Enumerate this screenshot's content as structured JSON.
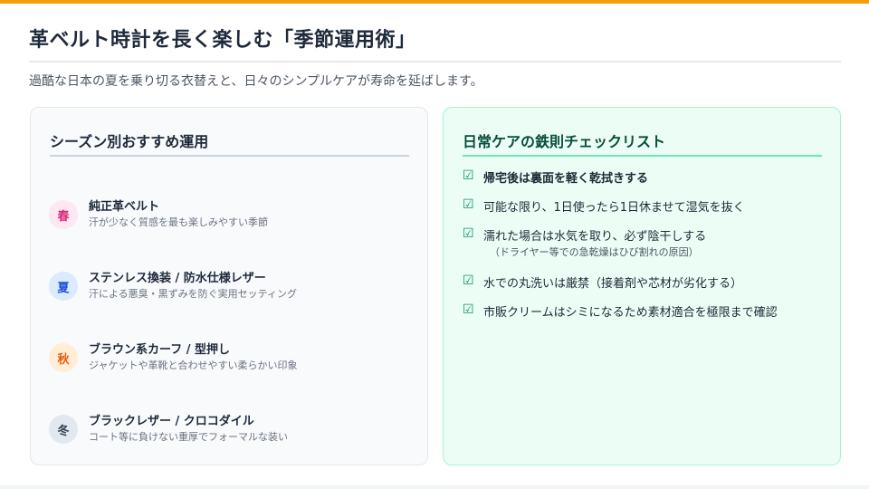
{
  "colors": {
    "accent_bar": "#f59e0b",
    "left_card_bg": "#f8fafc",
    "right_card_bg": "#ecfdf5",
    "check_mark": "#059669"
  },
  "header": {
    "title": "革ベルト時計を長く楽しむ「季節運用術」",
    "subtitle": "過酷な日本の夏を乗り切る衣替えと、日々のシンプルケアが寿命を延ばします。"
  },
  "seasons": {
    "title": "シーズン別おすすめ運用",
    "items": [
      {
        "badge": "春",
        "title": "純正革ベルト",
        "desc": "汗が少なく質感を最も楽しみやすい季節"
      },
      {
        "badge": "夏",
        "title": "ステンレス換装 / 防水仕様レザー",
        "desc": "汗による悪臭・黒ずみを防ぐ実用セッティング"
      },
      {
        "badge": "秋",
        "title": "ブラウン系カーフ / 型押し",
        "desc": "ジャケットや革靴と合わせやすい柔らかい印象"
      },
      {
        "badge": "冬",
        "title": "ブラックレザー / クロコダイル",
        "desc": "コート等に負けない重厚でフォーマルな装い"
      }
    ]
  },
  "checklist": {
    "title": "日常ケアの鉄則チェックリスト",
    "mark": "☑",
    "items": [
      {
        "text": "帰宅後は裏面を軽く乾拭きする"
      },
      {
        "text": "可能な限り、1日使ったら1日休ませて湿気を抜く"
      },
      {
        "text": "濡れた場合は水気を取り、必ず陰干しする",
        "note": "（ドライヤー等での急乾燥はひび割れの原因）"
      },
      {
        "text": "水での丸洗いは厳禁（接着剤や芯材が劣化する）"
      },
      {
        "text": "市販クリームはシミになるため素材適合を極限まで確認"
      }
    ]
  }
}
